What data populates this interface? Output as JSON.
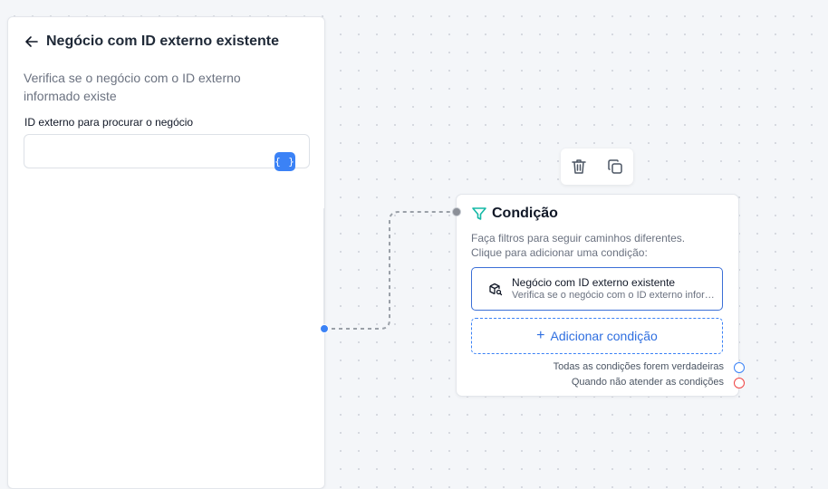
{
  "panel": {
    "title": "Negócio com ID externo existente",
    "description": "Verifica se o negócio com o ID externo informado existe",
    "field_label": "ID externo para procurar o negócio",
    "field_value": "",
    "field_placeholder": "",
    "variable_button": "{ }"
  },
  "toolbar": {
    "delete_icon": "trash-icon",
    "duplicate_icon": "copy-icon"
  },
  "condition_node": {
    "title": "Condição",
    "description": "Faça filtros para seguir caminhos diferentes. Clique para adicionar uma condição:",
    "items": [
      {
        "title": "Negócio com ID externo existente",
        "subtitle": "Verifica se o negócio com o ID externo informado existe",
        "icon": "package-search-icon"
      }
    ],
    "add_button": "Adicionar condição",
    "outputs": [
      {
        "label": "Todas as condições forem verdadeiras",
        "color": "#3b82f6"
      },
      {
        "label": "Quando não atender as condições",
        "color": "#ef4444"
      }
    ]
  },
  "colors": {
    "accent": "#3b82f6",
    "filter_icon": "#14b8a6",
    "false_output": "#ef4444"
  }
}
